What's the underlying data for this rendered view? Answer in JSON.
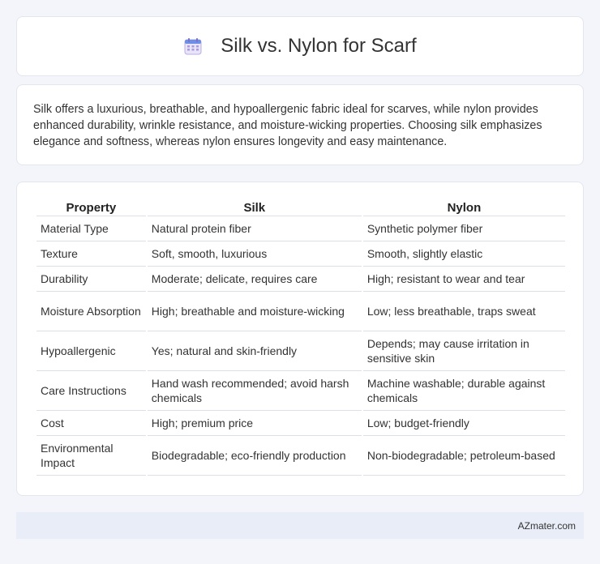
{
  "header": {
    "title": "Silk vs. Nylon for Scarf",
    "icon": "calendar-icon"
  },
  "intro": {
    "text": "Silk offers a luxurious, breathable, and hypoallergenic fabric ideal for scarves, while nylon provides enhanced durability, wrinkle resistance, and moisture-wicking properties. Choosing silk emphasizes elegance and softness, whereas nylon ensures longevity and easy maintenance."
  },
  "table": {
    "headers": [
      "Property",
      "Silk",
      "Nylon"
    ],
    "rows": [
      [
        "Material Type",
        "Natural protein fiber",
        "Synthetic polymer fiber"
      ],
      [
        "Texture",
        "Soft, smooth, luxurious",
        "Smooth, slightly elastic"
      ],
      [
        "Durability",
        "Moderate; delicate, requires care",
        "High; resistant to wear and tear"
      ],
      [
        "Moisture Absorption",
        "High; breathable and moisture-wicking",
        "Low; less breathable, traps sweat"
      ],
      [
        "Hypoallergenic",
        "Yes; natural and skin-friendly",
        "Depends; may cause irritation in sensitive skin"
      ],
      [
        "Care Instructions",
        "Hand wash recommended; avoid harsh chemicals",
        "Machine washable; durable against chemicals"
      ],
      [
        "Cost",
        "High; premium price",
        "Low; budget-friendly"
      ],
      [
        "Environmental Impact",
        "Biodegradable; eco-friendly production",
        "Non-biodegradable; petroleum-based"
      ]
    ]
  },
  "footer": {
    "text": "AZmater.com"
  }
}
